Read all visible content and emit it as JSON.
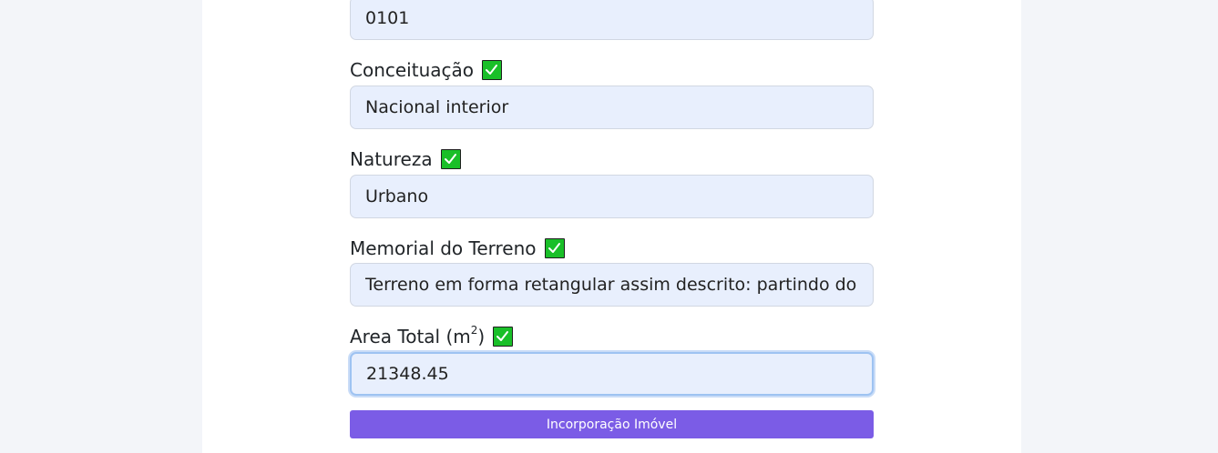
{
  "form": {
    "fields": [
      {
        "label": "",
        "value": "0101"
      },
      {
        "label": "Conceituação",
        "value": "Nacional interior"
      },
      {
        "label": "Natureza",
        "value": "Urbano"
      },
      {
        "label": "Memorial do Terreno",
        "value": "Terreno em forma retangular assim descrito: partindo do marco"
      },
      {
        "label_main": "Area Total (m",
        "label_sup": "2",
        "label_end": ")",
        "value": "21348.45"
      }
    ],
    "submit_label": "Incorporação Imóvel"
  },
  "colors": {
    "input_bg": "#e8effd",
    "check_green": "#19bf28",
    "button_purple": "#7b5ce6"
  }
}
